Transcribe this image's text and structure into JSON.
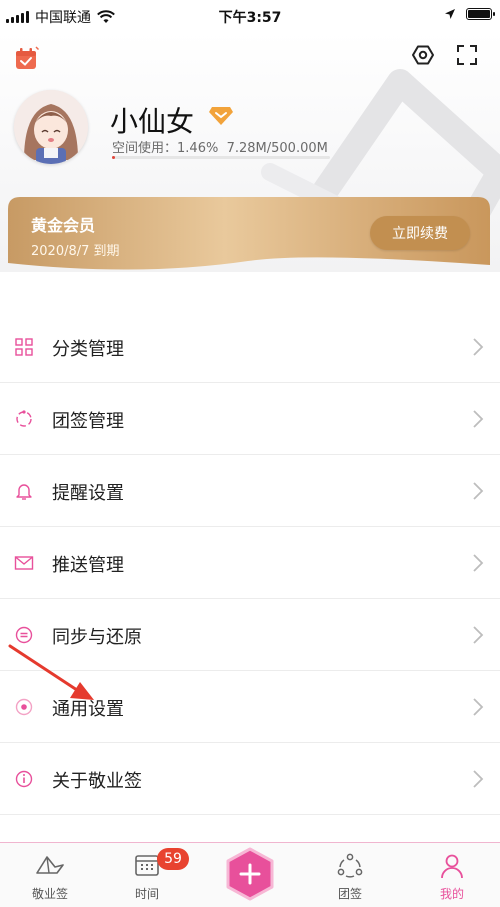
{
  "status_bar": {
    "carrier": "中国联通",
    "time": "下午3:57"
  },
  "profile": {
    "username": "小仙女",
    "storage_label": "空间使用：",
    "storage_percent": "1.46%",
    "storage_amount": "7.28M/500.00M",
    "storage_fraction": 0.0146
  },
  "vip": {
    "title": "黄金会员",
    "expire": "2020/8/7 到期",
    "renew_label": "立即续费"
  },
  "menu": {
    "items": [
      {
        "label": "分类管理",
        "icon": "category-grid-icon"
      },
      {
        "label": "团签管理",
        "icon": "team-circle-icon"
      },
      {
        "label": "提醒设置",
        "icon": "bell-icon"
      },
      {
        "label": "推送管理",
        "icon": "envelope-icon"
      },
      {
        "label": "同步与还原",
        "icon": "sync-icon"
      },
      {
        "label": "通用设置",
        "icon": "general-settings-icon"
      },
      {
        "label": "关于敬业签",
        "icon": "info-icon"
      }
    ]
  },
  "tabbar": {
    "tabs": [
      {
        "label": "敬业签",
        "icon": "notes-icon"
      },
      {
        "label": "时间",
        "icon": "calendar-icon"
      },
      {
        "label": "团签",
        "icon": "team-icon"
      },
      {
        "label": "我的",
        "icon": "person-icon"
      }
    ],
    "badge": "59",
    "active": "我的"
  },
  "colors": {
    "accent_pink": "#e8509b",
    "vip_gold": "#c28f50",
    "badge_red": "#e8432f"
  }
}
